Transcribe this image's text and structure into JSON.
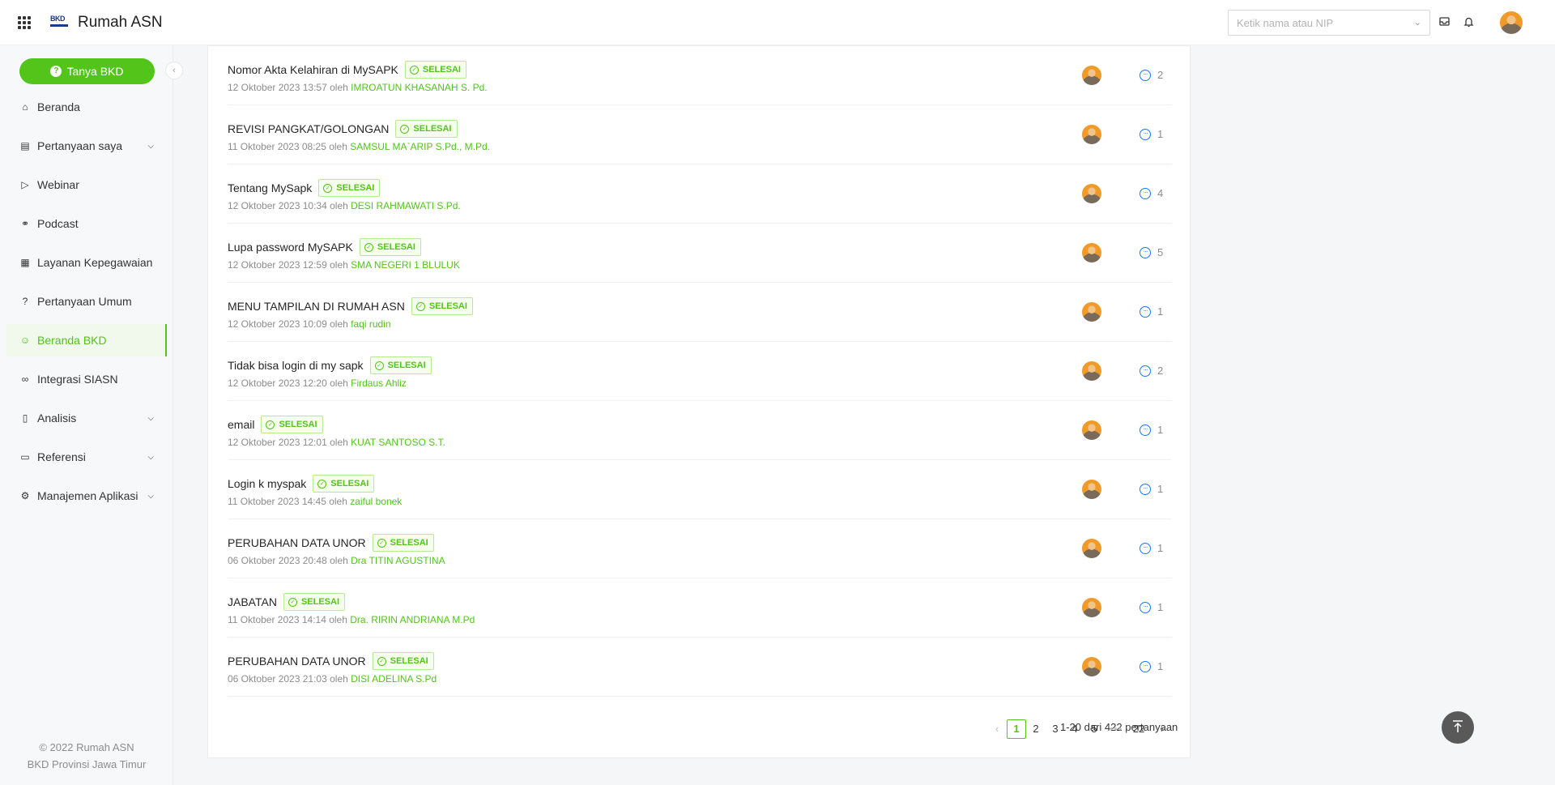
{
  "header": {
    "app_title": "Rumah ASN",
    "logo_text": "BKD",
    "search_placeholder": "Ketik nama atau NIP"
  },
  "sidebar": {
    "ask_button": "Tanya BKD",
    "items": [
      {
        "label": "Beranda",
        "icon": "home-icon"
      },
      {
        "label": "Pertanyaan saya",
        "icon": "file-icon",
        "expandable": true
      },
      {
        "label": "Webinar",
        "icon": "video-icon"
      },
      {
        "label": "Podcast",
        "icon": "microphone-icon"
      },
      {
        "label": "Layanan Kepegawaian",
        "icon": "apps-icon"
      },
      {
        "label": "Pertanyaan Umum",
        "icon": "question-icon"
      },
      {
        "label": "Beranda BKD",
        "icon": "team-icon",
        "active": true
      },
      {
        "label": "Integrasi SIASN",
        "icon": "api-icon"
      },
      {
        "label": "Analisis",
        "icon": "chart-icon",
        "expandable": true
      },
      {
        "label": "Referensi",
        "icon": "book-icon",
        "expandable": true
      },
      {
        "label": "Manajemen Aplikasi",
        "icon": "settings-icon",
        "expandable": true
      }
    ],
    "footer_line1": "© 2022 Rumah ASN",
    "footer_line2": "BKD Provinsi Jawa Timur"
  },
  "status_label": "SELESAI",
  "meta_by": "oleh",
  "questions": [
    {
      "title": "Nomor Akta Kelahiran di MySAPK",
      "date": "12 Oktober 2023 13:57",
      "author": "IMROATUN KHASANAH S. Pd.",
      "comments": "2"
    },
    {
      "title": "REVISI PANGKAT/GOLONGAN",
      "date": "11 Oktober 2023 08:25",
      "author": "SAMSUL MA`ARIP S.Pd., M.Pd.",
      "comments": "1"
    },
    {
      "title": "Tentang MySapk",
      "date": "12 Oktober 2023 10:34",
      "author": "DESI RAHMAWATI S.Pd.",
      "comments": "4"
    },
    {
      "title": "Lupa password MySAPK",
      "date": "12 Oktober 2023 12:59",
      "author": "SMA NEGERI 1 BLULUK",
      "comments": "5"
    },
    {
      "title": "MENU TAMPILAN DI RUMAH ASN",
      "date": "12 Oktober 2023 10:09",
      "author": "faqi rudin",
      "comments": "1"
    },
    {
      "title": "Tidak bisa login di my sapk",
      "date": "12 Oktober 2023 12:20",
      "author": "Firdaus Ahliz",
      "comments": "2"
    },
    {
      "title": "email",
      "date": "12 Oktober 2023 12:01",
      "author": "KUAT SANTOSO S.T.",
      "comments": "1"
    },
    {
      "title": "Login k myspak",
      "date": "11 Oktober 2023 14:45",
      "author": "zaiful bonek",
      "comments": "1"
    },
    {
      "title": "PERUBAHAN DATA UNOR",
      "date": "06 Oktober 2023 20:48",
      "author": "Dra TITIN AGUSTINA",
      "comments": "1"
    },
    {
      "title": "JABATAN",
      "date": "11 Oktober 2023 14:14",
      "author": "Dra. RIRIN ANDRIANA M.Pd",
      "comments": "1"
    },
    {
      "title": "PERUBAHAN DATA UNOR",
      "date": "06 Oktober 2023 21:03",
      "author": "DISI ADELINA S.Pd",
      "comments": "1"
    }
  ],
  "pagination": {
    "total_text": "1-20 dari 422 pertanyaan",
    "pages": [
      "1",
      "2",
      "3",
      "4",
      "5"
    ],
    "ellipsis": "•••",
    "last_page": "22",
    "current": "1"
  },
  "colors": {
    "accent": "#52c41a",
    "link_blue": "#1677ff"
  }
}
